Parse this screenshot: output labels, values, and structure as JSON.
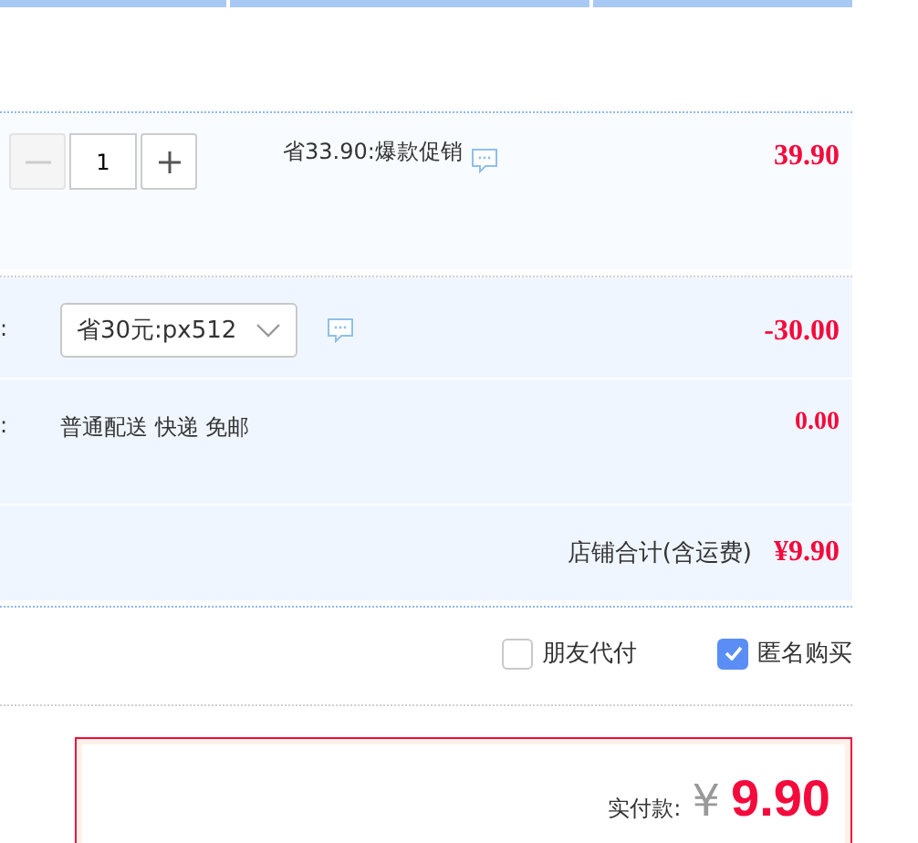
{
  "item_row": {
    "quantity": "1",
    "promo": "省33.90:爆款促销",
    "price": "39.90"
  },
  "coupon_row": {
    "label": ":",
    "coupon": "省30元:px512",
    "amount": "-30.00"
  },
  "shipping_row": {
    "label": ":",
    "method": "普通配送 快递 免邮",
    "amount": "0.00"
  },
  "shop_total": {
    "label": "店铺合计(含运费)",
    "amount": "¥9.90"
  },
  "options": [
    {
      "label": "朋友代付",
      "checked": false
    },
    {
      "label": "匿名购买",
      "checked": true
    }
  ],
  "payment": {
    "label": "实付款:",
    "currency": "¥",
    "amount": "9.90"
  }
}
